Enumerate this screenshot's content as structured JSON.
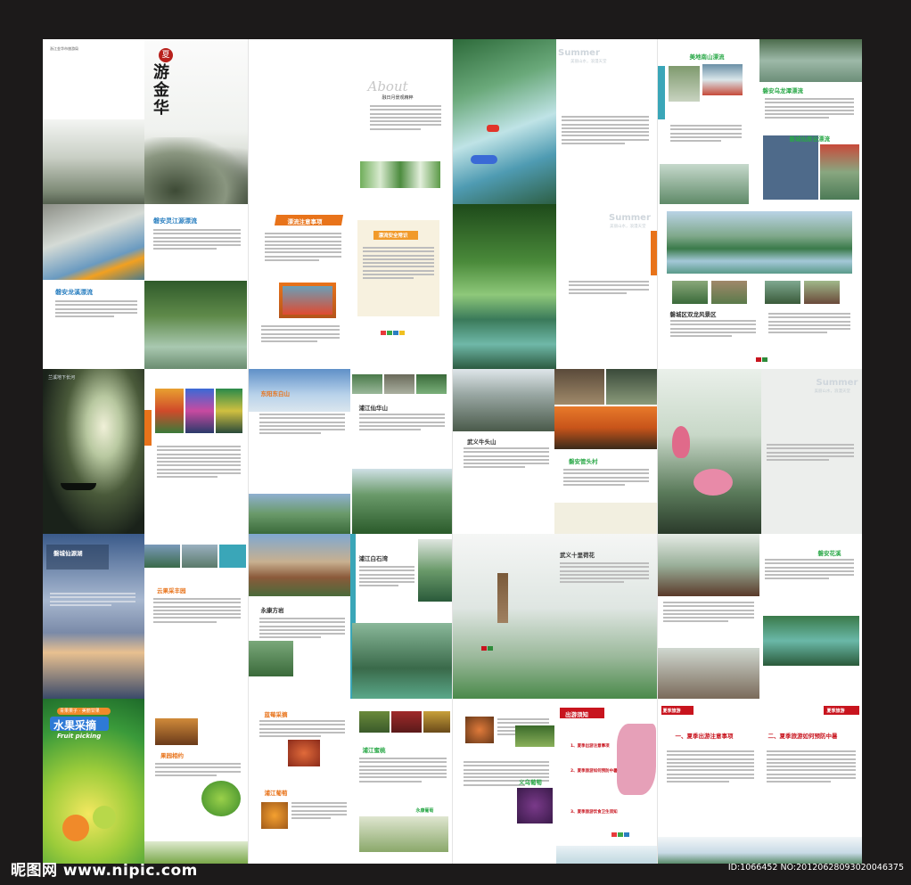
{
  "brochure": {
    "cover_title_chars": "游金华",
    "cover_seal": "夏",
    "cover_small_text": "浙江金华市旅游局",
    "about_title": "About",
    "about_sub": "融日月景观精粹",
    "summer_word": "Summer",
    "summer_sub": "美丽山水，浪漫天堂",
    "fruit_small": "青果果子 · 美丽甘果",
    "fruit_big": "水果采摘",
    "fruit_en": "Fruit picking",
    "travel_tips": "出游须知",
    "summer_travel": "夏季旅游"
  },
  "headings": {
    "meihua": "美地南山漂流",
    "panan_rock": "磐安乌龙潭漂流",
    "wuyi_rafting": "磐城仙原谷漂流",
    "panan_lingjiang": "磐安灵江源漂流",
    "panan_longxi": "磐安龙溪漂流",
    "rafting_notes": "漂流注意事项",
    "rafting_tips": "漂流安全常识",
    "shuanglong": "磐城区双龙风景区",
    "underground": "兰溪地下长河",
    "dongyang": "东阳东白山",
    "pujiang": "浦江仙华山",
    "wuyi_niutou": "武义牛头山",
    "panan_guantou": "磐安管头村",
    "xianyuan_lake": "磐城仙源湖",
    "fruit_guoyuan": "云果采丰园",
    "yongkang": "永康方岩",
    "pujiang_baishi": "浦江白石湾",
    "wuyi_lotus": "武义十里荷花",
    "panan_huaxi": "磐安花溪",
    "fruit_orchard": "果园相约",
    "fruit_yangmei": "蓝莓采摘",
    "fruit_pear": "浦江葡萄",
    "fruit_pick2": "浦江蜜桃",
    "fruit_grape": "永康葡萄",
    "fruit_peach": "义乌葡萄",
    "tips_1": "一、夏季出游注意事项",
    "tips_2": "二、夏季旅游如何预防中暑",
    "tips_mid1": "1、夏季出游注意事项",
    "tips_mid2": "2、夏季旅游如何预防中暑",
    "tips_mid3": "3、夏季旅游饮食卫生须知"
  },
  "watermark": {
    "logo": "昵图网 www.nipic.com",
    "id": "ID:1066452 NO:20120628093020046375"
  },
  "colors": {
    "background": "#1c1a1a",
    "accent_orange": "#e8731a",
    "accent_green": "#2e8b3a",
    "accent_red": "#c8141e",
    "heading_green": "#2aa848",
    "heading_blue": "#2a7fc0"
  }
}
